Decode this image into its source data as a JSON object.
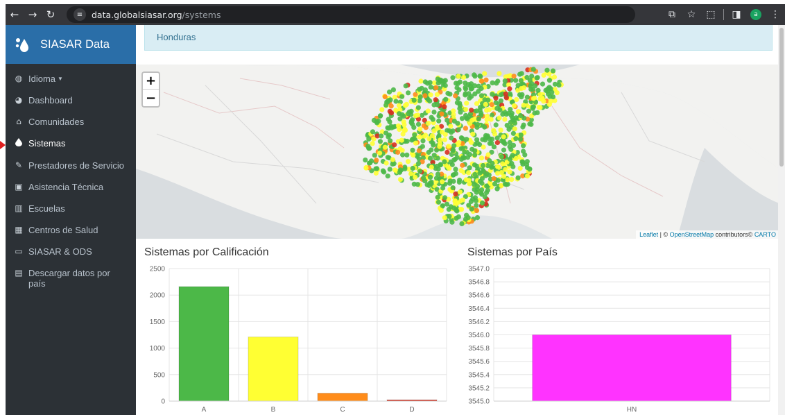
{
  "browser": {
    "nav_icons": [
      "back-icon",
      "forward-icon",
      "reload-icon"
    ],
    "url_host": "data.globalsiasar.org",
    "url_path": "/systems",
    "right_icons": [
      "translate-icon",
      "bookmark-star-icon",
      "extensions-icon",
      "side-panel-icon",
      "profile-avatar",
      "menu-icon"
    ],
    "profile_initial": "a"
  },
  "sidebar": {
    "brand": "SIASAR Data",
    "items": [
      {
        "label": "Idioma",
        "icon": "globe-icon",
        "has_caret": true
      },
      {
        "label": "Dashboard",
        "icon": "pie-chart-icon"
      },
      {
        "label": "Comunidades",
        "icon": "home-icon"
      },
      {
        "label": "Sistemas",
        "icon": "water-drop-icon",
        "active": true
      },
      {
        "label": "Prestadores de Servicio",
        "icon": "wrench-icon"
      },
      {
        "label": "Asistencia Técnica",
        "icon": "clipboard-icon"
      },
      {
        "label": "Escuelas",
        "icon": "school-icon"
      },
      {
        "label": "Centros de Salud",
        "icon": "hospital-icon"
      },
      {
        "label": "SIASAR & ODS",
        "icon": "monitor-icon"
      },
      {
        "label": "Descargar datos por país",
        "icon": "file-download-icon"
      }
    ]
  },
  "main": {
    "country_banner": "Honduras",
    "map": {
      "zoom_in": "+",
      "zoom_out": "−",
      "attribution": {
        "leaflet": "Leaflet",
        "sep": " | © ",
        "osm": "OpenStreetMap",
        "contributors": " contributors© ",
        "carto": "CARTO"
      },
      "marker_colors": {
        "A": "#4cb848",
        "B": "#ffff33",
        "C": "#ff8c1a",
        "D": "#d7301f"
      }
    }
  },
  "chart_data": [
    {
      "type": "bar",
      "title": "Sistemas por Calificación",
      "categories": [
        "A",
        "B",
        "C",
        "D"
      ],
      "values": [
        2160,
        1210,
        150,
        25
      ],
      "colors": [
        "#4cb848",
        "#ffff33",
        "#ff8c1a",
        "#d7301f"
      ],
      "ylim": [
        0,
        2500
      ],
      "yticks": [
        0,
        500,
        1000,
        1500,
        2000,
        2500
      ],
      "grid": true
    },
    {
      "type": "bar",
      "title": "Sistemas por País",
      "categories": [
        "HN"
      ],
      "values": [
        3546
      ],
      "colors": [
        "#ff33ff"
      ],
      "ylim": [
        3545.0,
        3547.0
      ],
      "yticks": [
        "3545.0",
        "3545.2",
        "3545.4",
        "3545.6",
        "3545.8",
        "3546.0",
        "3546.2",
        "3546.4",
        "3546.6",
        "3546.8",
        "3547.0"
      ],
      "grid": true
    }
  ]
}
